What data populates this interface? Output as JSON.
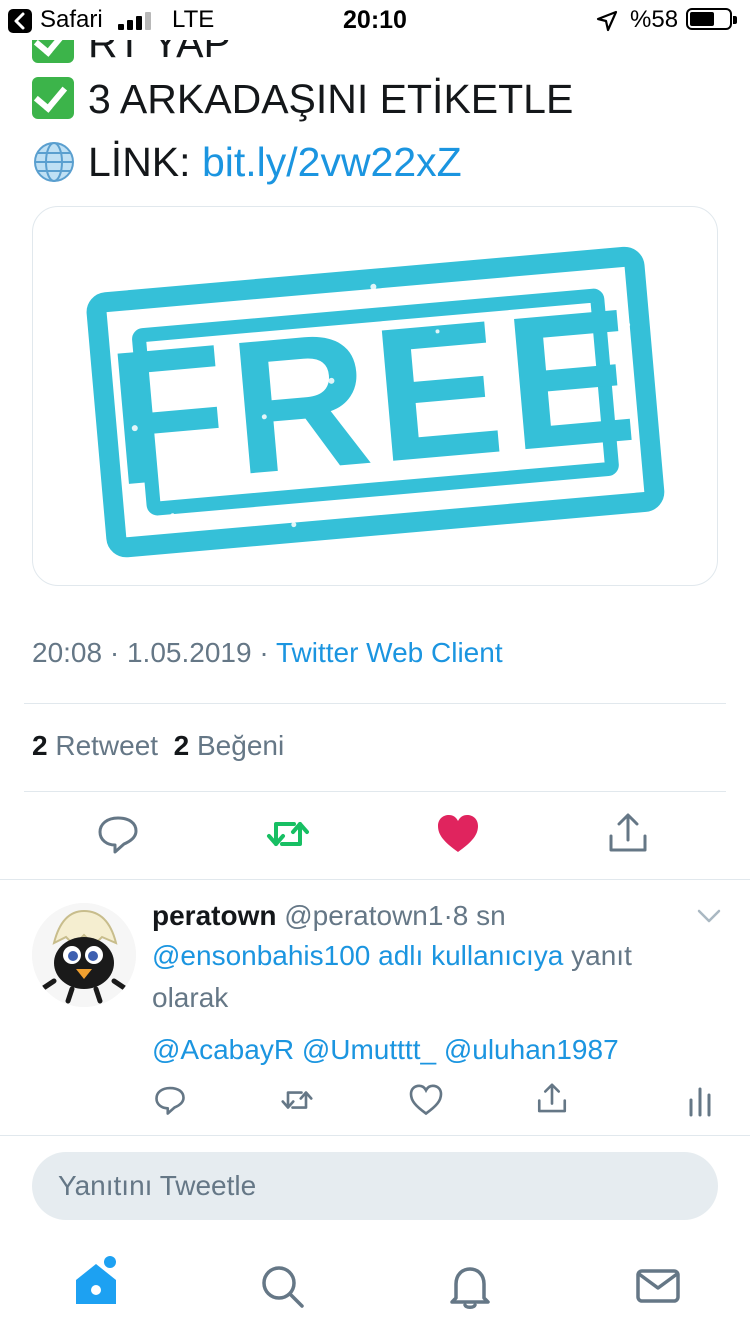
{
  "status_bar": {
    "back_app": "Safari",
    "network": "LTE",
    "time": "20:10",
    "battery": "%58",
    "battery_level": 0.58,
    "signal_bars_filled": 3,
    "signal_bars_total": 4
  },
  "tweet": {
    "clipped_line": "RT YAP",
    "line_tag": "3 ARKADAŞINI ETİKETLE",
    "link_prefix": "LİNK:",
    "link_url": "bit.ly/2vw22xZ",
    "image_word": "FREE",
    "time": "20:08",
    "date": "1.05.2019",
    "client": "Twitter Web Client",
    "retweet_count": "2",
    "retweet_label": "Retweet",
    "like_count": "2",
    "like_label": "Beğeni"
  },
  "actions": {
    "reply_icon": "reply-icon",
    "retweet_icon": "retweet-icon",
    "like_icon": "heart-filled-icon",
    "share_icon": "share-icon"
  },
  "reply": {
    "name": "peratown",
    "handle": "@peratown1",
    "separator": "·",
    "age": "8 sn",
    "replying_to": "@ensonbahis100 adlı kullanıcıya",
    "replying_suffix": "yanıt",
    "replying_line2": "olarak",
    "mention_1": "@AcabayR",
    "mention_2": "@Umutttt_",
    "mention_3": "@uluhan1987"
  },
  "compose": {
    "placeholder": "Yanıtını Tweetle"
  },
  "tabbar": [
    "home-icon",
    "search-icon",
    "notifications-icon",
    "messages-icon"
  ],
  "colors": {
    "accent": "#1b95e0",
    "retweet": "#17bf63",
    "like": "#e0245e",
    "muted": "#657786",
    "stamp": "#35c0d8"
  }
}
